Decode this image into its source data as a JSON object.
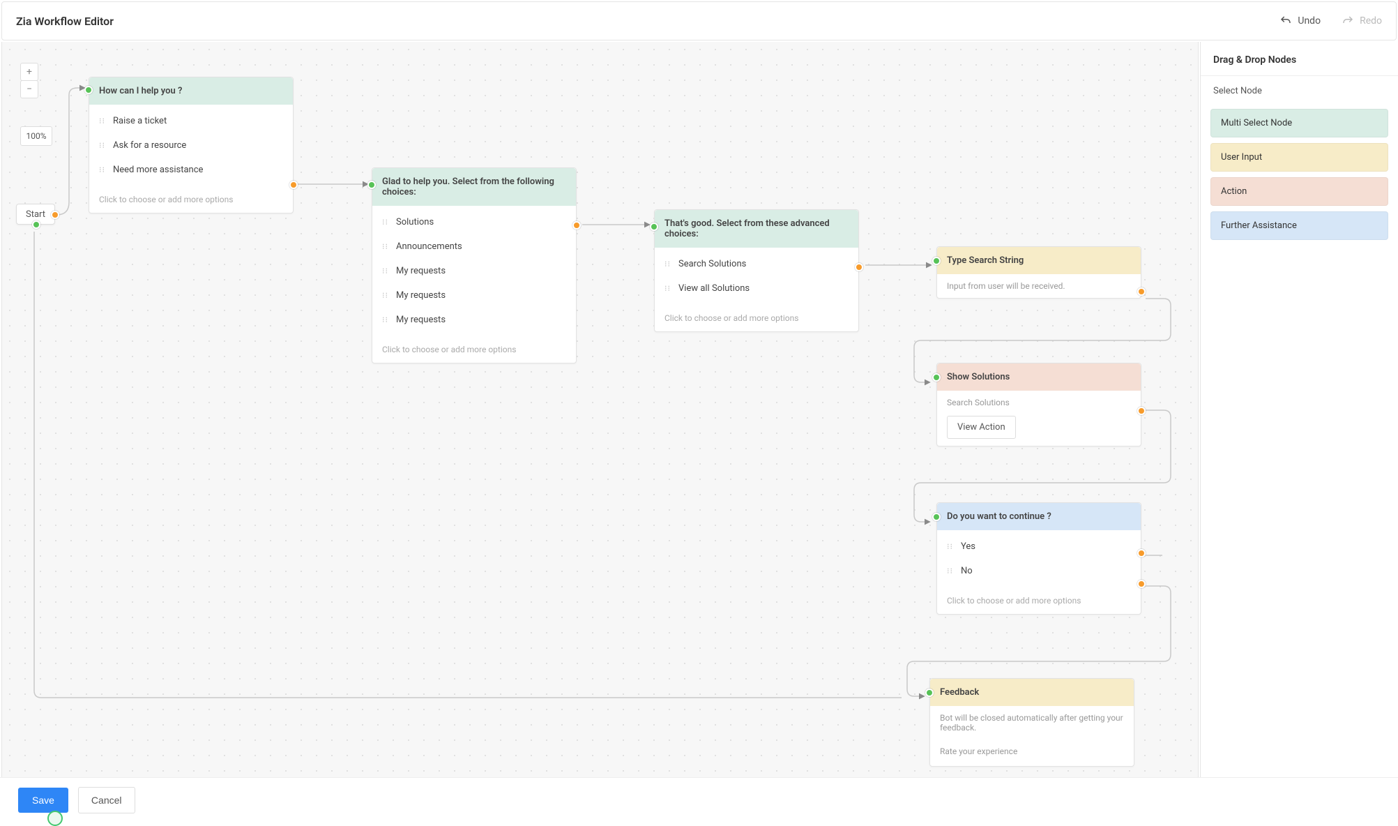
{
  "topbar": {
    "title": "Zia Workflow Editor",
    "undo_label": "Undo",
    "redo_label": "Redo"
  },
  "zoom": {
    "plus": "+",
    "minus": "−",
    "level": "100%"
  },
  "start": {
    "label": "Start"
  },
  "nodes": {
    "n1": {
      "title": "How can I help you ?",
      "items": [
        "Raise a ticket",
        "Ask for a resource",
        "Need more assistance"
      ],
      "hint": "Click to choose or add more options"
    },
    "n2": {
      "title": "Glad to help you. Select from the following choices:",
      "items": [
        "Solutions",
        "Announcements",
        "My requests",
        "My requests",
        "My requests"
      ],
      "hint": "Click to choose or add more options"
    },
    "n3": {
      "title": "That's good. Select from these advanced choices:",
      "items": [
        "Search Solutions",
        "View all Solutions"
      ],
      "hint": "Click to choose or add more options"
    },
    "n4": {
      "title": "Type Search String",
      "subtext": "Input from user will be received."
    },
    "n5": {
      "title": "Show Solutions",
      "meta": "Search Solutions",
      "button": "View Action"
    },
    "n6": {
      "title": "Do you want to continue ?",
      "items": [
        "Yes",
        "No"
      ],
      "hint": "Click to choose or add more options"
    },
    "n7": {
      "title": "Feedback",
      "subtext": "Bot will be closed automatically after getting your feedback.",
      "meta": "Rate your experience"
    }
  },
  "palette": {
    "header": "Drag & Drop Nodes",
    "sub": "Select Node",
    "items": [
      {
        "label": "Multi Select Node",
        "color": "#d9ede5"
      },
      {
        "label": "User Input",
        "color": "#f7ecc8"
      },
      {
        "label": "Action",
        "color": "#f5ded4"
      },
      {
        "label": "Further Assistance",
        "color": "#d6e6f7"
      }
    ]
  },
  "footer": {
    "save": "Save",
    "cancel": "Cancel"
  }
}
